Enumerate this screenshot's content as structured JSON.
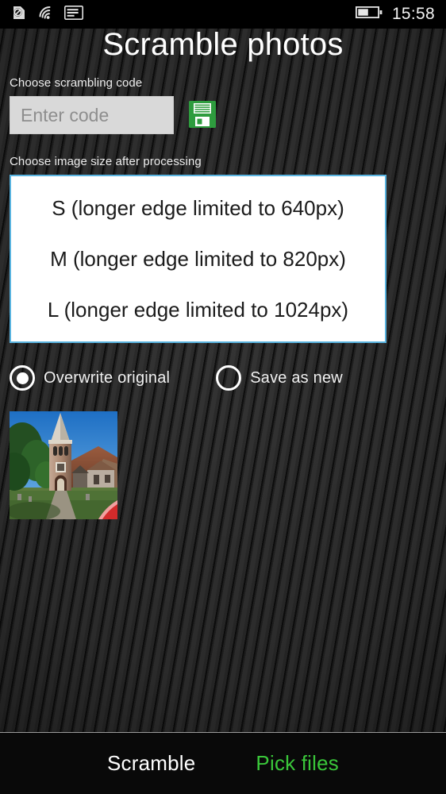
{
  "status_bar": {
    "icons": [
      {
        "name": "sim-missing-icon",
        "glyph": "sim-slash"
      },
      {
        "name": "wifi-icon",
        "glyph": "wifi"
      },
      {
        "name": "sim-card-icon",
        "glyph": "sim-card"
      }
    ],
    "battery": {
      "name": "battery-icon",
      "level_percent": 55
    },
    "clock": "15:58"
  },
  "header": {
    "title": "Scramble photos"
  },
  "code_section": {
    "label": "Choose scrambling code",
    "input_value": "",
    "input_placeholder": "Enter code",
    "save_icon_name": "floppy-disk-save-icon"
  },
  "size_section": {
    "label": "Choose image size after processing",
    "options": [
      "S (longer edge limited to 640px)",
      "M (longer edge limited to 820px)",
      "L (longer edge limited to 1024px)"
    ],
    "selected_index": null
  },
  "output_mode": {
    "options": [
      {
        "label": "Overwrite original",
        "selected": true
      },
      {
        "label": "Save as new",
        "selected": false
      }
    ]
  },
  "thumbnails": [
    {
      "name": "selected-photo-thumbnail",
      "description": "Church with stone tower and spire",
      "remove_badge_name": "remove-photo-badge"
    }
  ],
  "app_bar": {
    "scramble_label": "Scramble",
    "pick_files_label": "Pick files"
  },
  "colors": {
    "accent_green": "#3ac73a",
    "listbox_border": "#5ab4e0",
    "background": "#2e2e2e",
    "input_background": "#d9d9d9",
    "remove_badge": "#d32b2b",
    "save_icon_green": "#2e9c3e"
  }
}
